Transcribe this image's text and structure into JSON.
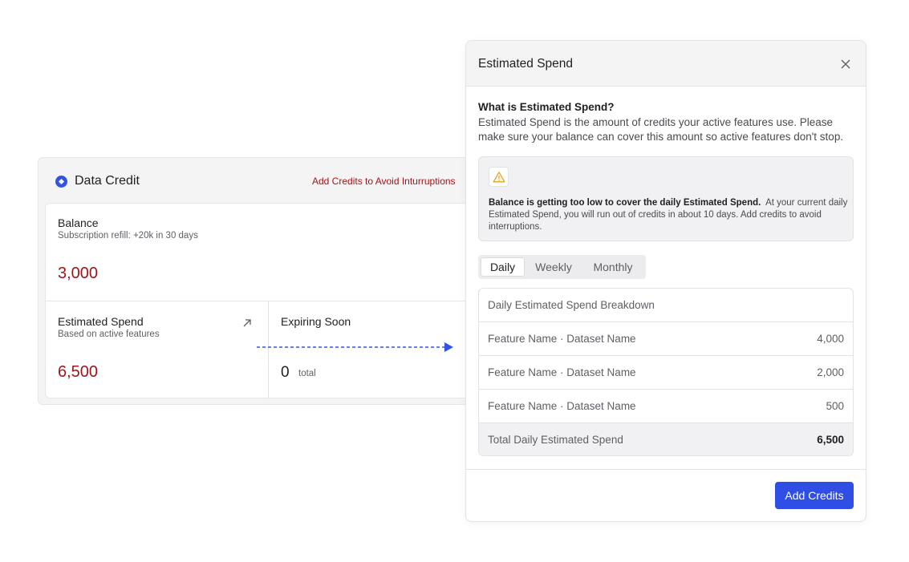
{
  "card": {
    "title": "Data Credit",
    "alert_link": "Add Credits to Avoid Inturruptions",
    "balance": {
      "label": "Balance",
      "subtitle": "Subscription refill: +20k in 30 days",
      "value": "3,000"
    },
    "estimated_spend": {
      "label": "Estimated Spend",
      "subtitle": "Based on active features",
      "value": "6,500"
    },
    "expiring_soon": {
      "label": "Expiring Soon",
      "value": "0",
      "unit": "total"
    }
  },
  "modal": {
    "title": "Estimated Spend",
    "question": "What is Estimated Spend?",
    "description": "Estimated Spend is the amount of credits your active features use. Please make sure your balance can cover this amount so active features don't stop.",
    "warning": {
      "strong": "Balance is getting too low to cover the daily Estimated Spend.",
      "body": "At your current daily Estimated Spend, you will run out of credits in about 10 days. Add credits to avoid interruptions."
    },
    "tabs": [
      {
        "label": "Daily",
        "active": true
      },
      {
        "label": "Weekly",
        "active": false
      },
      {
        "label": "Monthly",
        "active": false
      }
    ],
    "breakdown": {
      "header": "Daily Estimated Spend Breakdown",
      "rows": [
        {
          "label": "Feature Name · Dataset Name",
          "value": "4,000"
        },
        {
          "label": "Feature Name · Dataset Name",
          "value": "2,000"
        },
        {
          "label": "Feature Name · Dataset Name",
          "value": "500"
        }
      ],
      "total": {
        "label": "Total Daily Estimated Spend",
        "value": "6,500"
      }
    },
    "add_button": "Add Credits"
  },
  "colors": {
    "accent": "#2f4ee6",
    "danger": "#a3141a",
    "warning": "#f0a020"
  },
  "icons": [
    "data-credit-icon",
    "external-arrow-icon",
    "close-icon",
    "warning-icon",
    "dashed-arrow-icon"
  ]
}
